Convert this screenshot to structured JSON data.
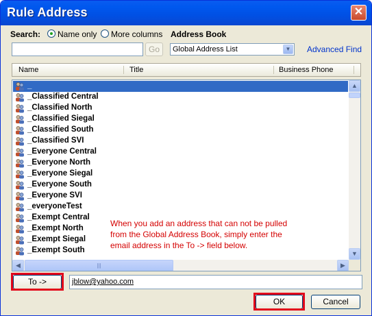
{
  "window": {
    "title": "Rule Address",
    "close_glyph": "✕"
  },
  "search": {
    "label": "Search:",
    "name_only_label": "Name only",
    "more_columns_label": "More columns",
    "selected": "name_only",
    "input_value": "",
    "go_label": "Go"
  },
  "address_book": {
    "label": "Address Book",
    "selected": "Global Address List",
    "advanced_find_label": "Advanced Find"
  },
  "columns": [
    "Name",
    "Title",
    "Business Phone"
  ],
  "list": {
    "items": [
      {
        "name": "_",
        "selected": true
      },
      {
        "name": "_Classified Central"
      },
      {
        "name": "_Classified North"
      },
      {
        "name": "_Classified Siegal"
      },
      {
        "name": "_Classified South"
      },
      {
        "name": "_Classified SVI"
      },
      {
        "name": "_Everyone Central"
      },
      {
        "name": "_Everyone North"
      },
      {
        "name": "_Everyone Siegal"
      },
      {
        "name": "_Everyone South"
      },
      {
        "name": "_Everyone SVI"
      },
      {
        "name": "_everyoneTest"
      },
      {
        "name": "_Exempt Central"
      },
      {
        "name": "_Exempt North"
      },
      {
        "name": "_Exempt Siegal"
      },
      {
        "name": "_Exempt South"
      }
    ],
    "item_icon": "distribution-list-icon"
  },
  "annotation": {
    "text": "When you add an address that can not be pulled\nfrom the Global Address Book, simply enter the\nemail address in the To -> field below.",
    "color": "#d40000"
  },
  "to": {
    "button_label": "To ->",
    "value": "jblow@yahoo.com"
  },
  "footer": {
    "ok_label": "OK",
    "cancel_label": "Cancel"
  },
  "highlight_color": "#e2061a"
}
